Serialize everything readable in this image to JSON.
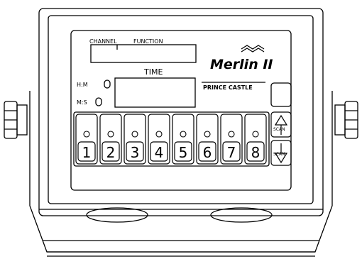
{
  "labels": {
    "channel": "CHANNEL",
    "function": "FUNCTION",
    "time": "TIME",
    "hm": "H:M",
    "ms": "M:S",
    "brand": "Merlin II",
    "maker": "PRINCE CASTLE",
    "scan_up": "SCAN",
    "scan_down": "SCAN"
  },
  "channel_keys": [
    "1",
    "2",
    "3",
    "4",
    "5",
    "6",
    "7",
    "8"
  ],
  "colors": {
    "line": "#000000",
    "background": "#ffffff"
  }
}
